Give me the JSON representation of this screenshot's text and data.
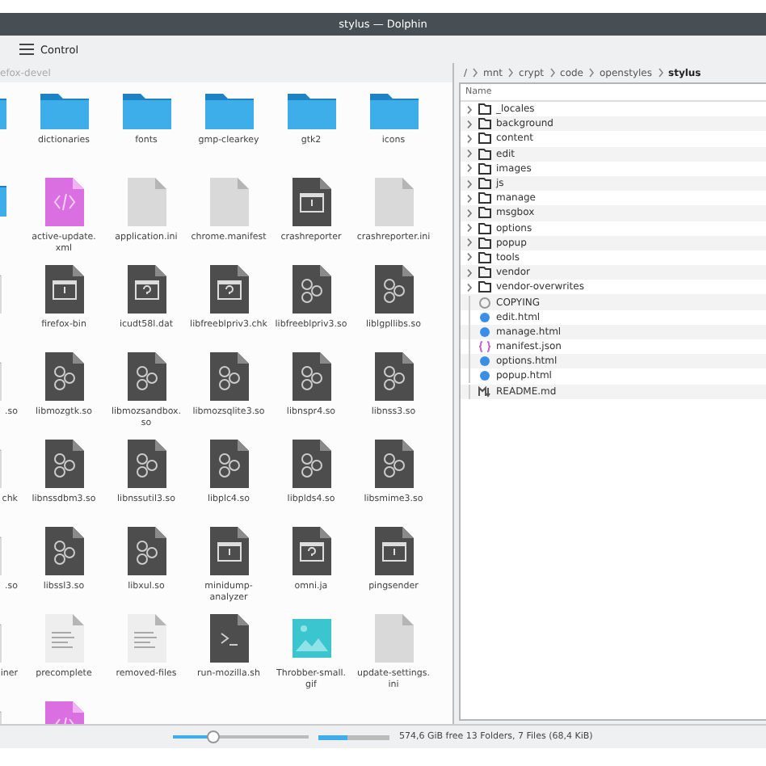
{
  "window": {
    "title": "stylus — Dolphin"
  },
  "toolbar": {
    "menu_label": "Control"
  },
  "left_pane": {
    "path": "efox-devel",
    "rows": [
      [
        {
          "kind": "folder"
        },
        {
          "kind": "folder",
          "label": "dictionaries"
        },
        {
          "kind": "folder",
          "label": "fonts"
        },
        {
          "kind": "folder",
          "label": "gmp-clearkey"
        },
        {
          "kind": "folder",
          "label": "gtk2"
        },
        {
          "kind": "folder",
          "label": "icons"
        }
      ],
      [
        {
          "kind": "folder"
        },
        {
          "kind": "xml",
          "label": "active-update.\nxml"
        },
        {
          "kind": "plain",
          "label": "application.ini"
        },
        {
          "kind": "plain",
          "label": "chrome.manifest"
        },
        {
          "kind": "exec",
          "label": "crashreporter"
        },
        {
          "kind": "plain",
          "label": "crashreporter.ini"
        }
      ],
      [
        {
          "kind": "plain"
        },
        {
          "kind": "exec",
          "label": "firefox-bin"
        },
        {
          "kind": "unknown",
          "label": "icudt58l.dat"
        },
        {
          "kind": "unknown",
          "label": "libfreeblpriv3.chk"
        },
        {
          "kind": "lib",
          "label": "libfreeblpriv3.so"
        },
        {
          "kind": "lib",
          "label": "liblgpllibs.so"
        }
      ],
      [
        {
          "kind": "plain",
          "label": ".so"
        },
        {
          "kind": "lib",
          "label": "libmozgtk.so"
        },
        {
          "kind": "lib",
          "label": "libmozsandbox.\nso"
        },
        {
          "kind": "lib",
          "label": "libmozsqlite3.so"
        },
        {
          "kind": "lib",
          "label": "libnspr4.so"
        },
        {
          "kind": "lib",
          "label": "libnss3.so"
        }
      ],
      [
        {
          "kind": "plain",
          "label": "chk"
        },
        {
          "kind": "lib",
          "label": "libnssdbm3.so"
        },
        {
          "kind": "lib",
          "label": "libnssutil3.so"
        },
        {
          "kind": "lib",
          "label": "libplc4.so"
        },
        {
          "kind": "lib",
          "label": "libplds4.so"
        },
        {
          "kind": "lib",
          "label": "libsmime3.so"
        }
      ],
      [
        {
          "kind": "plain",
          "label": ".so"
        },
        {
          "kind": "lib",
          "label": "libssl3.so"
        },
        {
          "kind": "lib",
          "label": "libxul.so"
        },
        {
          "kind": "exec",
          "label": "minidump-\nanalyzer"
        },
        {
          "kind": "unknown",
          "label": "omni.ja"
        },
        {
          "kind": "exec",
          "label": "pingsender"
        }
      ],
      [
        {
          "kind": "plain",
          "label": "iner"
        },
        {
          "kind": "lines",
          "label": "precomplete"
        },
        {
          "kind": "lines",
          "label": "removed-files"
        },
        {
          "kind": "script",
          "label": "run-mozilla.sh"
        },
        {
          "kind": "image",
          "label": "Throbber-small.\ngif"
        },
        {
          "kind": "plain",
          "label": "update-settings.\nini"
        }
      ],
      [
        {
          "kind": "plain"
        },
        {
          "kind": "xml"
        }
      ]
    ]
  },
  "breadcrumb": [
    {
      "label": "/",
      "current": false
    },
    {
      "label": "mnt",
      "current": false
    },
    {
      "label": "crypt",
      "current": false
    },
    {
      "label": "code",
      "current": false
    },
    {
      "label": "openstyles",
      "current": false
    },
    {
      "label": "stylus",
      "current": true
    }
  ],
  "tree": {
    "header": "Name",
    "items": [
      {
        "kind": "folder",
        "name": "_locales"
      },
      {
        "kind": "folder",
        "name": "background"
      },
      {
        "kind": "folder",
        "name": "content"
      },
      {
        "kind": "folder",
        "name": "edit"
      },
      {
        "kind": "folder",
        "name": "images"
      },
      {
        "kind": "folder",
        "name": "js"
      },
      {
        "kind": "folder",
        "name": "manage"
      },
      {
        "kind": "folder",
        "name": "msgbox"
      },
      {
        "kind": "folder",
        "name": "options"
      },
      {
        "kind": "folder",
        "name": "popup"
      },
      {
        "kind": "folder",
        "name": "tools"
      },
      {
        "kind": "folder",
        "name": "vendor"
      },
      {
        "kind": "folder",
        "name": "vendor-overwrites"
      },
      {
        "kind": "license",
        "name": "COPYING"
      },
      {
        "kind": "html",
        "name": "edit.html"
      },
      {
        "kind": "html",
        "name": "manage.html"
      },
      {
        "kind": "json",
        "name": "manifest.json"
      },
      {
        "kind": "html",
        "name": "options.html"
      },
      {
        "kind": "html",
        "name": "popup.html"
      },
      {
        "kind": "markdown",
        "name": "README.md"
      }
    ]
  },
  "status_bar": {
    "zoom": {
      "level": 0.3
    },
    "space": {
      "level": 0.4
    },
    "text": "574,6 GiB free 13 Folders, 7 Files (68,4 KiB)"
  }
}
